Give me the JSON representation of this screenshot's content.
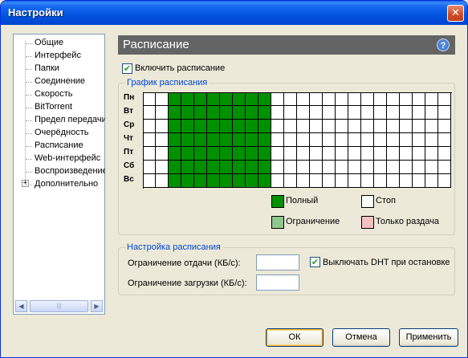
{
  "window": {
    "title": "Настройки",
    "close_glyph": "✕"
  },
  "sidebar": {
    "items": [
      {
        "label": "Общие"
      },
      {
        "label": "Интерфейс"
      },
      {
        "label": "Папки"
      },
      {
        "label": "Соединение"
      },
      {
        "label": "Скорость"
      },
      {
        "label": "BitTorrent"
      },
      {
        "label": "Предел передачи"
      },
      {
        "label": "Очерёдность"
      },
      {
        "label": "Расписание",
        "selected": true
      },
      {
        "label": "Web-интерфейс"
      },
      {
        "label": "Воспроизведение"
      },
      {
        "label": "Дополнительно",
        "expandable": true
      }
    ],
    "expander_glyph": "+",
    "scroll_left_glyph": "◀",
    "scroll_right_glyph": "▶",
    "scroll_thumb_grip": "|||"
  },
  "panel": {
    "title": "Расписание",
    "help_glyph": "?",
    "enable_checkbox": {
      "label": "Включить расписание",
      "checked": true,
      "check_glyph": "✔"
    }
  },
  "schedule_group": {
    "label": "График расписания",
    "days": [
      "Пн",
      "Вт",
      "Ср",
      "Чт",
      "Пт",
      "Сб",
      "Вс"
    ],
    "hours_count": 24,
    "full_hours": [
      2,
      3,
      4,
      5,
      6,
      7,
      8,
      9
    ],
    "legend": [
      {
        "label": "Полный",
        "color": "#009000"
      },
      {
        "label": "Стоп",
        "color": "#ffffff"
      },
      {
        "label": "Ограничение",
        "color": "#8fc78f"
      },
      {
        "label": "Только раздача",
        "color": "#f6c1c1"
      }
    ]
  },
  "settings_group": {
    "label": "Настройка расписания",
    "upload_limit": {
      "label": "Ограничение отдачи (КБ/с):",
      "value": ""
    },
    "download_limit": {
      "label": "Ограничение загрузки (КБ/с):",
      "value": ""
    },
    "dht_checkbox": {
      "label": "Выключать DHT при остановке",
      "checked": true,
      "check_glyph": "✔"
    }
  },
  "buttons": {
    "ok": "ОК",
    "cancel": "Отмена",
    "apply": "Применить"
  },
  "colors": {
    "title_bar": "#0052e0",
    "header_bg": "#646464",
    "group_label": "#0046d5",
    "full": "#009000"
  }
}
